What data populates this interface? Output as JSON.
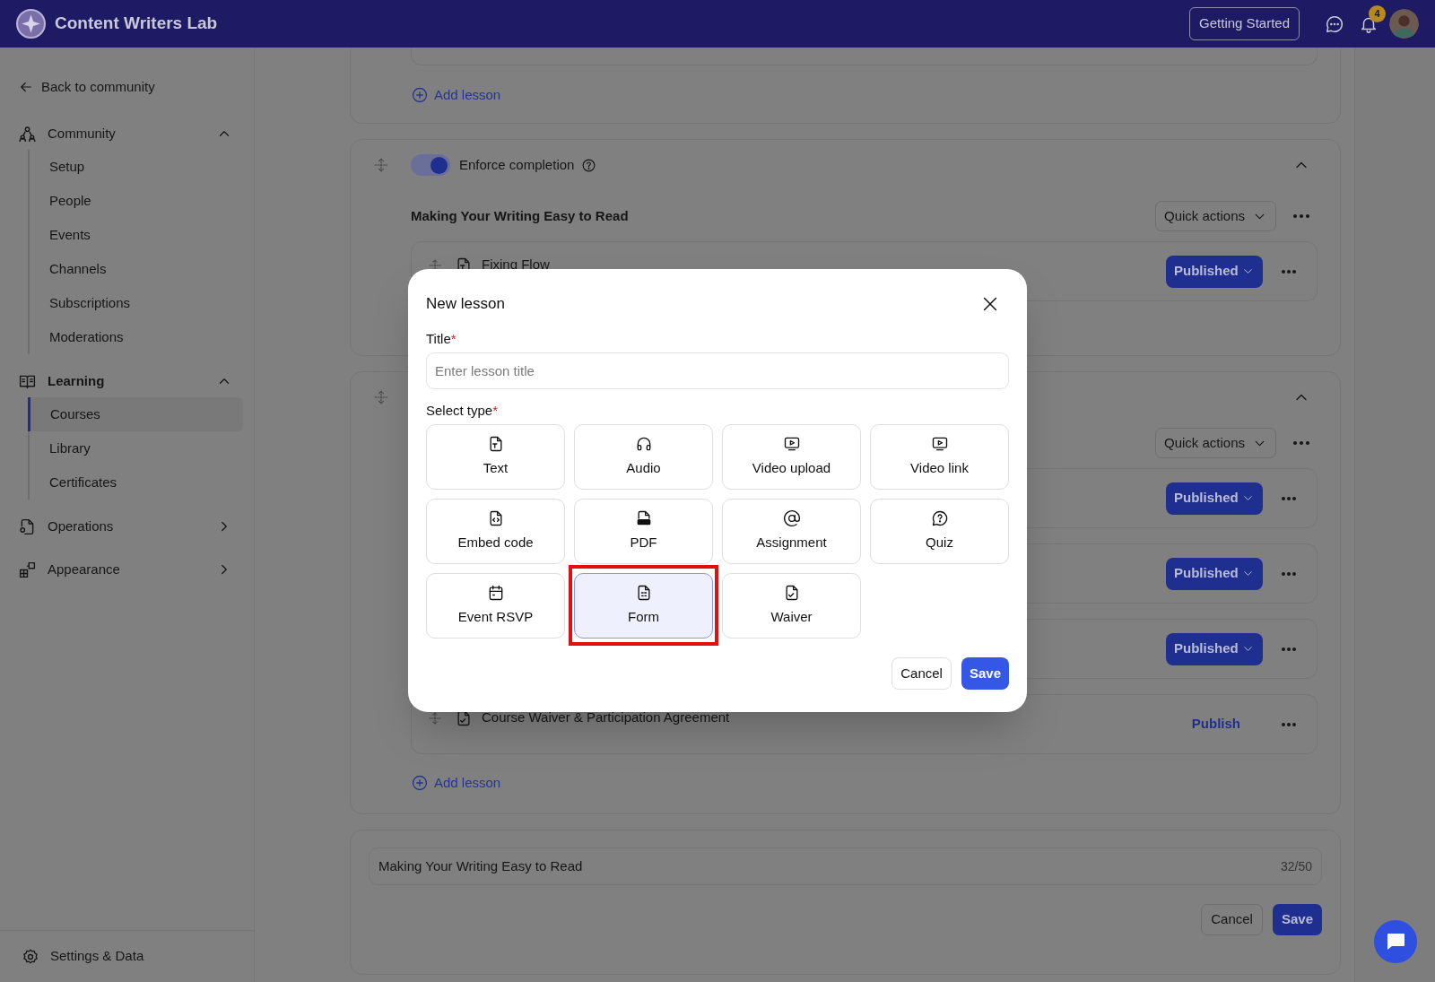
{
  "app": {
    "title": "Content Writers Lab",
    "getting_started": "Getting Started",
    "notification_count": "4"
  },
  "sidebar": {
    "back": "Back to community",
    "sections": [
      {
        "label": "Community",
        "expanded": true,
        "children": [
          {
            "label": "Setup",
            "selected": false
          },
          {
            "label": "People",
            "selected": false
          },
          {
            "label": "Events",
            "selected": false
          },
          {
            "label": "Channels",
            "selected": false
          },
          {
            "label": "Subscriptions",
            "selected": false
          },
          {
            "label": "Moderations",
            "selected": false
          }
        ]
      },
      {
        "label": "Learning",
        "expanded": true,
        "children": [
          {
            "label": "Courses",
            "selected": true
          },
          {
            "label": "Library",
            "selected": false
          },
          {
            "label": "Certificates",
            "selected": false
          }
        ]
      },
      {
        "label": "Operations",
        "expanded": false
      },
      {
        "label": "Appearance",
        "expanded": false
      }
    ],
    "footer": "Settings & Data"
  },
  "modules": [
    {
      "add_lesson": "Add lesson"
    },
    {
      "enforce_completion": {
        "label": "Enforce completion",
        "on": true
      },
      "title": "Making Your Writing Easy to Read",
      "quick_actions": "Quick actions",
      "lessons": [
        {
          "kind": "text",
          "title": "Fixing Flow",
          "status": "Published",
          "published": true
        }
      ]
    },
    {
      "quick_actions": "Quick actions",
      "lessons": [
        {
          "status": "Published",
          "published": true
        },
        {
          "status": "Published",
          "published": true
        },
        {
          "status": "Published",
          "published": true
        },
        {
          "kind": "waiver",
          "title": "Course Waiver & Participation Agreement",
          "status": "Publish",
          "published": false
        }
      ],
      "add_lesson": "Add lesson"
    }
  ],
  "module_form": {
    "value": "Making Your Writing Easy to Read",
    "counter": "32/50",
    "cancel": "Cancel",
    "save": "Save"
  },
  "modal": {
    "title": "New lesson",
    "title_label": "Title",
    "required_mark": "*",
    "placeholder": "Enter lesson title",
    "type_label": "Select type",
    "types": [
      {
        "label": "Text",
        "selected": false,
        "highlighted": false
      },
      {
        "label": "Audio",
        "selected": false,
        "highlighted": false
      },
      {
        "label": "Video upload",
        "selected": false,
        "highlighted": false
      },
      {
        "label": "Video link",
        "selected": false,
        "highlighted": false
      },
      {
        "label": "Embed code",
        "selected": false,
        "highlighted": false
      },
      {
        "label": "PDF",
        "selected": false,
        "highlighted": false
      },
      {
        "label": "Assignment",
        "selected": false,
        "highlighted": false
      },
      {
        "label": "Quiz",
        "selected": false,
        "highlighted": false
      },
      {
        "label": "Event RSVP",
        "selected": false,
        "highlighted": false
      },
      {
        "label": "Form",
        "selected": true,
        "highlighted": true
      },
      {
        "label": "Waiver",
        "selected": false,
        "highlighted": false
      }
    ],
    "cancel": "Cancel",
    "save": "Save"
  }
}
